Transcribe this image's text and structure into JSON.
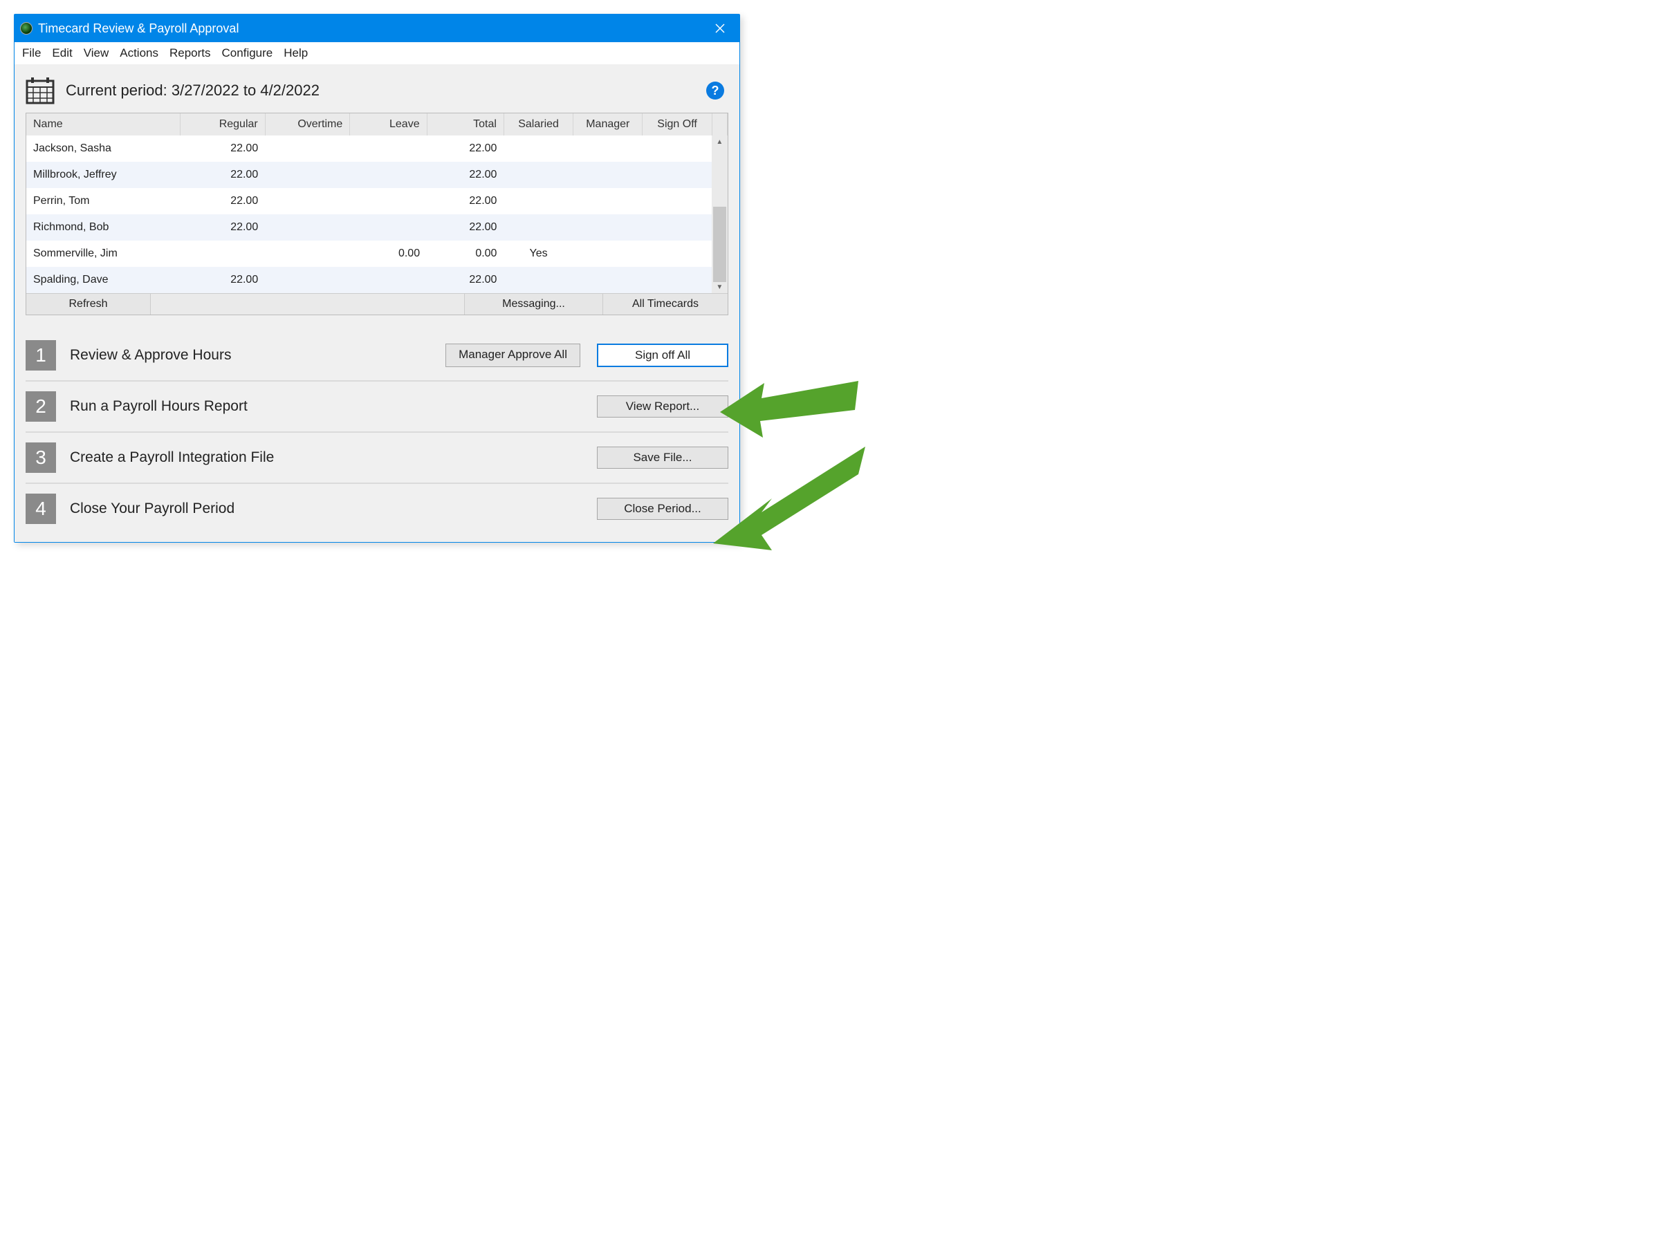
{
  "window": {
    "title": "Timecard Review & Payroll Approval"
  },
  "menubar": [
    "File",
    "Edit",
    "View",
    "Actions",
    "Reports",
    "Configure",
    "Help"
  ],
  "period": {
    "label": "Current period: 3/27/2022 to 4/2/2022"
  },
  "grid": {
    "headers": [
      "Name",
      "Regular",
      "Overtime",
      "Leave",
      "Total",
      "Salaried",
      "Manager",
      "Sign Off"
    ],
    "rows": [
      {
        "name": "Jackson, Sasha",
        "regular": "22.00",
        "overtime": "",
        "leave": "",
        "total": "22.00",
        "salaried": "",
        "manager": "",
        "signoff": ""
      },
      {
        "name": "Millbrook, Jeffrey",
        "regular": "22.00",
        "overtime": "",
        "leave": "",
        "total": "22.00",
        "salaried": "",
        "manager": "",
        "signoff": ""
      },
      {
        "name": "Perrin, Tom",
        "regular": "22.00",
        "overtime": "",
        "leave": "",
        "total": "22.00",
        "salaried": "",
        "manager": "",
        "signoff": ""
      },
      {
        "name": "Richmond, Bob",
        "regular": "22.00",
        "overtime": "",
        "leave": "",
        "total": "22.00",
        "salaried": "",
        "manager": "",
        "signoff": ""
      },
      {
        "name": "Sommerville, Jim",
        "regular": "",
        "overtime": "",
        "leave": "0.00",
        "total": "0.00",
        "salaried": "Yes",
        "manager": "",
        "signoff": ""
      },
      {
        "name": "Spalding, Dave",
        "regular": "22.00",
        "overtime": "",
        "leave": "",
        "total": "22.00",
        "salaried": "",
        "manager": "",
        "signoff": ""
      }
    ]
  },
  "footer": {
    "refresh": "Refresh",
    "messaging": "Messaging...",
    "all_timecards": "All Timecards"
  },
  "steps": [
    {
      "num": "1",
      "label": "Review & Approve Hours",
      "buttons": [
        "Manager Approve All",
        "Sign off All"
      ],
      "hl": 1
    },
    {
      "num": "2",
      "label": "Run a Payroll Hours Report",
      "buttons": [
        "View Report..."
      ]
    },
    {
      "num": "3",
      "label": "Create a Payroll Integration File",
      "buttons": [
        "Save File..."
      ]
    },
    {
      "num": "4",
      "label": "Close Your Payroll Period",
      "buttons": [
        "Close Period..."
      ]
    }
  ]
}
